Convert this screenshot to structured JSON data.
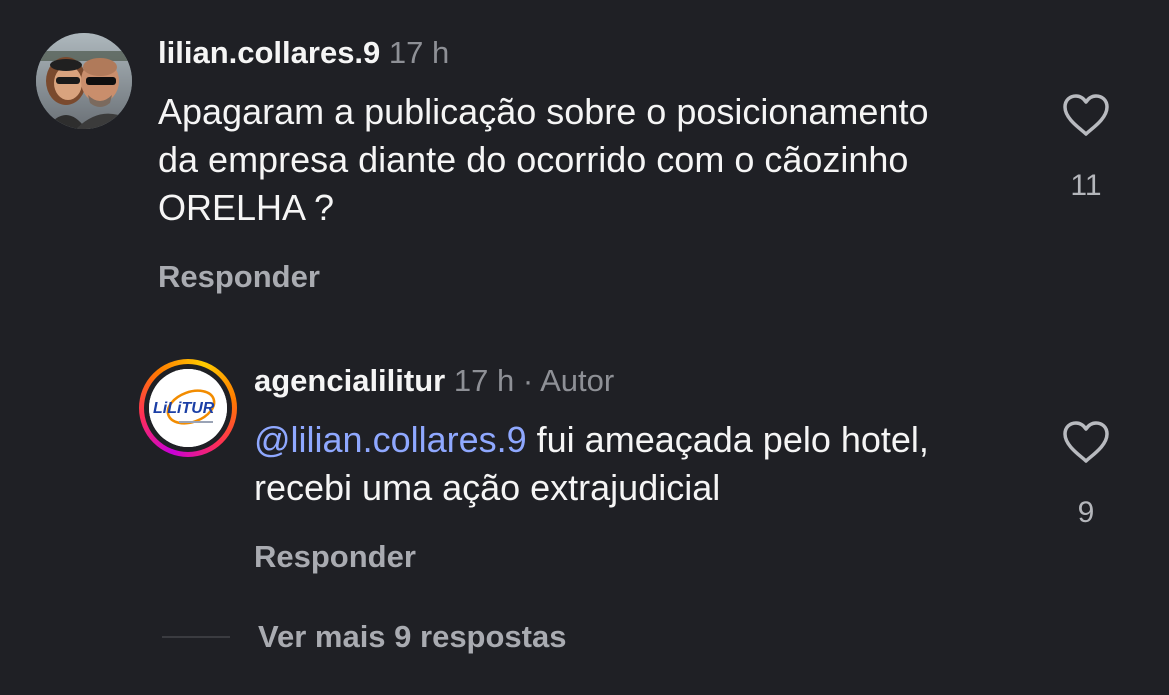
{
  "comments": [
    {
      "username": "lilian.collares.9",
      "time": "17 h",
      "text": "Apagaram a publicação sobre o posicionamento da empresa diante do ocorrido com o cãozinho ORELHA ?",
      "likes": "11",
      "reply_label": "Responder"
    },
    {
      "username": "agencialilitur",
      "time": "17 h",
      "separator": "·",
      "author_badge": "Autor",
      "mention": "@lilian.collares.9",
      "text": " fui ameaçada pelo hotel, recebi uma ação extrajudicial",
      "likes": "9",
      "reply_label": "Responder",
      "logo_text": "LiLiTUR"
    }
  ],
  "more_replies_label": "Ver mais 9 respostas",
  "colors": {
    "background": "#1f2025",
    "mention": "#8fa8ff",
    "meta": "#8e9096"
  }
}
